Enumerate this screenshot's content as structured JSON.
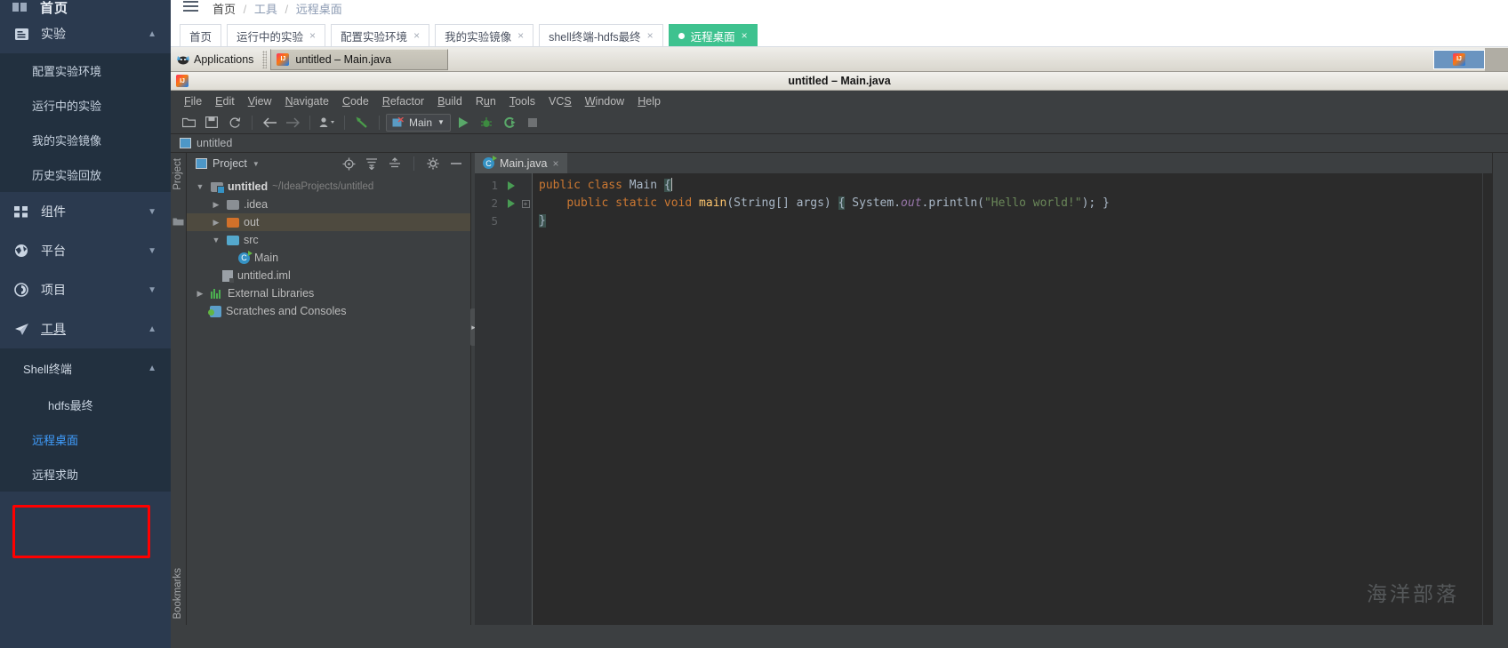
{
  "webnav": {
    "home_label": "首页",
    "groups": [
      {
        "label": "实验",
        "icon": "document-icon",
        "expanded": true,
        "items": [
          "配置实验环境",
          "运行中的实验",
          "我的实验镜像",
          "历史实验回放"
        ]
      },
      {
        "label": "组件",
        "icon": "grid-icon",
        "expanded": false,
        "items": []
      },
      {
        "label": "平台",
        "icon": "globe-icon",
        "expanded": false,
        "items": []
      },
      {
        "label": "项目",
        "icon": "project-icon",
        "expanded": false,
        "items": []
      },
      {
        "label": "工具",
        "icon": "paper-plane-icon",
        "expanded": true,
        "items": []
      }
    ],
    "tools_sub": {
      "head": "Shell终端",
      "items": [
        "hdfs最终",
        "远程桌面",
        "远程求助"
      ],
      "active": "远程桌面",
      "highlight_color": "#ff0000",
      "active_color": "#409eff"
    }
  },
  "breadcrumb": {
    "items": [
      "首页",
      "工具",
      "远程桌面"
    ],
    "separator": "/"
  },
  "apptabs": {
    "tabs": [
      {
        "label": "首页",
        "closable": false,
        "active": false
      },
      {
        "label": "运行中的实验",
        "closable": true,
        "active": false
      },
      {
        "label": "配置实验环境",
        "closable": true,
        "active": false
      },
      {
        "label": "我的实验镜像",
        "closable": true,
        "active": false
      },
      {
        "label": "shell终端-hdfs最终",
        "closable": true,
        "active": false
      },
      {
        "label": "远程桌面",
        "closable": true,
        "active": true
      }
    ],
    "close_glyph": "×",
    "active_color": "#3ec28f"
  },
  "xfce": {
    "applications_label": "Applications",
    "window_button_label": "untitled – Main.java"
  },
  "ide": {
    "window_title": "untitled – Main.java",
    "menu": [
      {
        "label": "File",
        "mnemonic": "F"
      },
      {
        "label": "Edit",
        "mnemonic": "E"
      },
      {
        "label": "View",
        "mnemonic": "V"
      },
      {
        "label": "Navigate",
        "mnemonic": "N"
      },
      {
        "label": "Code",
        "mnemonic": "C"
      },
      {
        "label": "Refactor",
        "mnemonic": "R"
      },
      {
        "label": "Build",
        "mnemonic": "B"
      },
      {
        "label": "Run",
        "mnemonic": "u"
      },
      {
        "label": "Tools",
        "mnemonic": "T"
      },
      {
        "label": "VCS",
        "mnemonic": "S"
      },
      {
        "label": "Window",
        "mnemonic": "W"
      },
      {
        "label": "Help",
        "mnemonic": "H"
      }
    ],
    "toolbar": {
      "open_icon": "open-folder-icon",
      "save_icon": "save-icon",
      "sync_icon": "refresh-icon",
      "back_icon": "arrow-left-icon",
      "forward_icon": "arrow-right-icon",
      "profile_icon": "user-dropdown-icon",
      "update_icon": "update-project-icon",
      "run_config_label": "Main",
      "run_icon": "run-icon",
      "debug_icon": "debug-icon",
      "coverage_icon": "run-coverage-icon",
      "stop_icon": "stop-icon"
    },
    "navbar": {
      "project_label": "untitled"
    },
    "left_strip": {
      "top_label": "Project",
      "bottom_label": "Bookmarks"
    },
    "project_panel": {
      "title": "Project",
      "icons": [
        "locate-icon",
        "expand-all-icon",
        "collapse-all-icon",
        "settings-gear-icon",
        "hide-icon"
      ],
      "tree": [
        {
          "depth": 0,
          "label": "untitled",
          "note": "~/IdeaProjects/untitled",
          "icon": "module-icon",
          "arrow": "down",
          "bold": true,
          "selected": false
        },
        {
          "depth": 1,
          "label": ".idea",
          "note": "",
          "icon": "folder-gray-icon",
          "arrow": "right",
          "bold": false,
          "selected": false
        },
        {
          "depth": 1,
          "label": "out",
          "note": "",
          "icon": "folder-orange-icon",
          "arrow": "right",
          "bold": false,
          "selected": true
        },
        {
          "depth": 1,
          "label": "src",
          "note": "",
          "icon": "folder-blue-icon",
          "arrow": "down",
          "bold": false,
          "selected": false
        },
        {
          "depth": 2,
          "label": "Main",
          "note": "",
          "icon": "java-class-icon",
          "arrow": "none",
          "bold": false,
          "selected": false
        },
        {
          "depth": 1,
          "label": "untitled.iml",
          "note": "",
          "icon": "iml-file-icon",
          "arrow": "none",
          "bold": false,
          "selected": false
        },
        {
          "depth": 0,
          "label": "External Libraries",
          "note": "",
          "icon": "libraries-icon",
          "arrow": "right",
          "bold": false,
          "selected": false
        },
        {
          "depth": 0,
          "label": "Scratches and Consoles",
          "note": "",
          "icon": "scratches-icon",
          "arrow": "none",
          "bold": false,
          "selected": false
        }
      ]
    },
    "editor": {
      "tab_label": "Main.java",
      "tab_close_glyph": "×",
      "line_numbers": [
        "1",
        "2",
        "5"
      ],
      "code_lines": [
        "public class Main {",
        "    public static void main(String[] args) { System.out.println(\"Hello world!\"); }",
        "}"
      ],
      "string_literal": "\"Hello world!\""
    },
    "watermark": "海洋部落"
  }
}
